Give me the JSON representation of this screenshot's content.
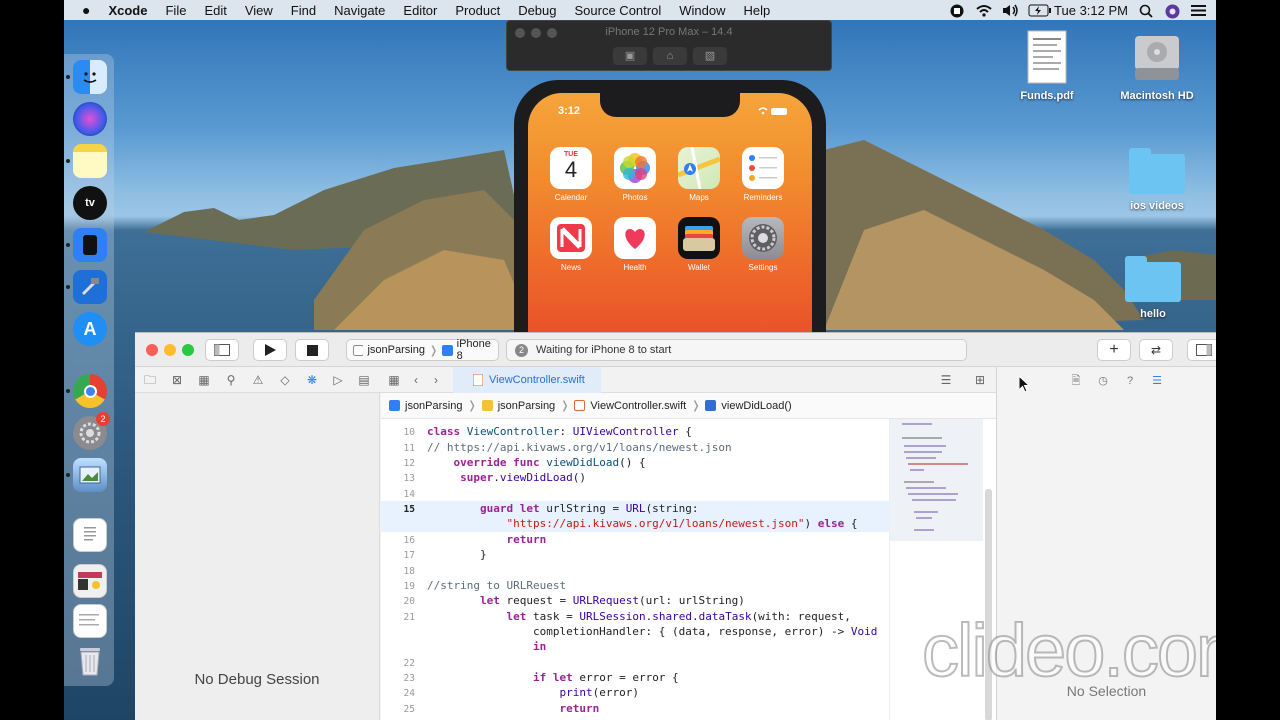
{
  "menubar": {
    "app": "Xcode",
    "items": [
      "File",
      "Edit",
      "View",
      "Find",
      "Navigate",
      "Editor",
      "Product",
      "Debug",
      "Source Control",
      "Window",
      "Help"
    ],
    "clock": "Tue 3:12 PM"
  },
  "desktop": {
    "items": [
      {
        "label": "Funds.pdf"
      },
      {
        "label": "Macintosh HD"
      },
      {
        "label": "ios videos"
      },
      {
        "label": "hello"
      }
    ]
  },
  "dock": {
    "badge": "2"
  },
  "simulator": {
    "title": "iPhone 12 Pro Max – 14.4",
    "status_time": "3:12",
    "calendar_day": "TUE",
    "calendar_date": "4",
    "apps": [
      {
        "label": "Calendar"
      },
      {
        "label": "Photos"
      },
      {
        "label": "Maps"
      },
      {
        "label": "Reminders"
      },
      {
        "label": "News"
      },
      {
        "label": "Health"
      },
      {
        "label": "Wallet"
      },
      {
        "label": "Settings"
      }
    ]
  },
  "xcode": {
    "scheme": "jsonParsing",
    "device": "iPhone 8",
    "status_badge": "2",
    "status": "Waiting for iPhone 8 to start",
    "tab": "ViewController.swift",
    "jump": [
      "jsonParsing",
      "jsonParsing",
      "ViewController.swift",
      "viewDidLoad()"
    ],
    "debug_message": "No Debug Session",
    "inspector_message": "No Selection",
    "line_numbers": [
      "10",
      "11",
      "12",
      "13",
      "14",
      "15",
      "16",
      "17",
      "18",
      "19",
      "20",
      "21",
      "22",
      "23",
      "24",
      "25"
    ]
  },
  "watermark": "clideo.com"
}
